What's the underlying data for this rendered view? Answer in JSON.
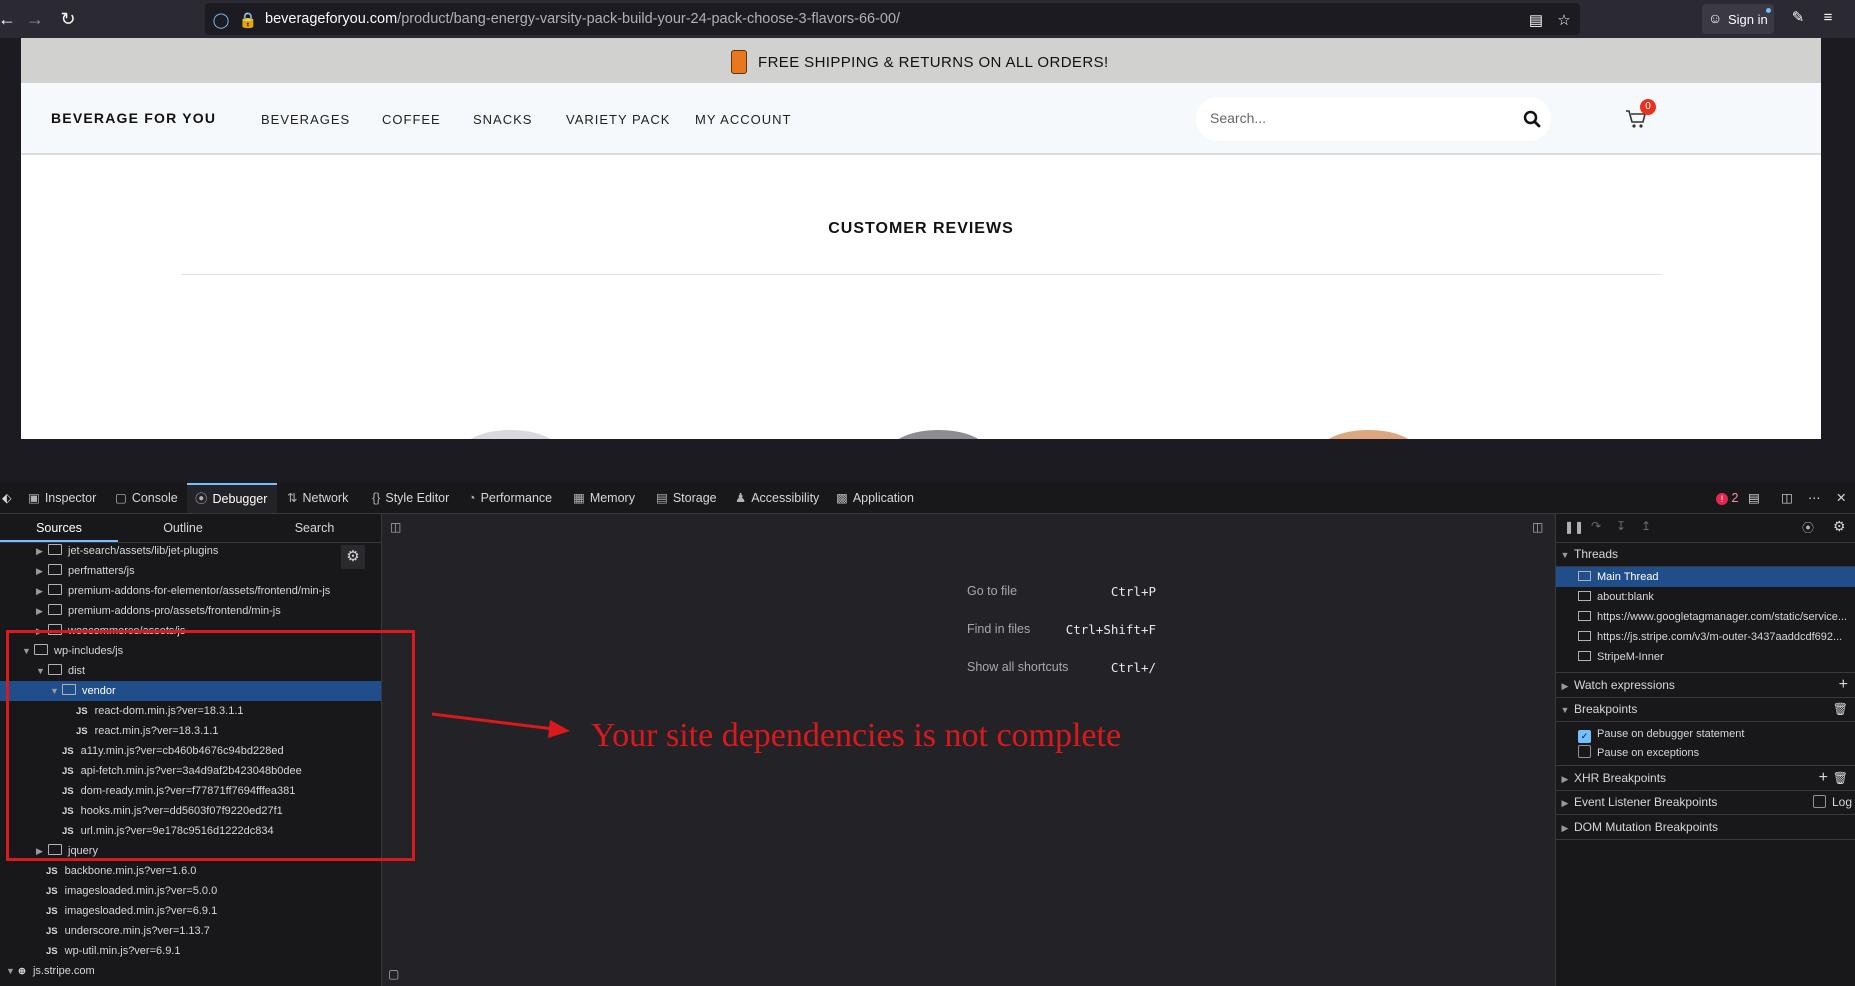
{
  "browser": {
    "url_domain": "beverageforyou.com",
    "url_path": "/product/bang-energy-varsity-pack-build-your-24-pack-choose-3-flavors-66-00/",
    "sign_in_label": "Sign in"
  },
  "site": {
    "promo": "FREE SHIPPING & RETURNS ON ALL ORDERS!",
    "logo": "BEVERAGE FOR YOU",
    "nav": [
      "BEVERAGES",
      "COFFEE",
      "SNACKS",
      "VARIETY PACK",
      "MY ACCOUNT"
    ],
    "search_placeholder": "Search...",
    "cart_count": "0",
    "reviews_title": "CUSTOMER REVIEWS"
  },
  "devtools": {
    "tabs": [
      "Inspector",
      "Console",
      "Debugger",
      "Network",
      "Style Editor",
      "Performance",
      "Memory",
      "Storage",
      "Accessibility",
      "Application"
    ],
    "active_tab": "Debugger",
    "error_count": "2",
    "source_tabs": [
      "Sources",
      "Outline",
      "Search"
    ],
    "tree": [
      {
        "label": "jet-search/assets/lib/jet-plugins",
        "kind": "folder"
      },
      {
        "label": "perfmatters/js",
        "kind": "folder"
      },
      {
        "label": "premium-addons-for-elementor/assets/frontend/min-js",
        "kind": "folder"
      },
      {
        "label": "premium-addons-pro/assets/frontend/min-js",
        "kind": "folder"
      },
      {
        "label": "woocommerce/assets/js",
        "kind": "folder"
      },
      {
        "label": "wp-includes/js",
        "kind": "folder"
      },
      {
        "label": "dist",
        "kind": "folder"
      },
      {
        "label": "vendor",
        "kind": "folder"
      },
      {
        "label": "react-dom.min.js?ver=18.3.1.1",
        "kind": "js"
      },
      {
        "label": "react.min.js?ver=18.3.1.1",
        "kind": "js"
      },
      {
        "label": "a11y.min.js?ver=cb460b4676c94bd228ed",
        "kind": "js"
      },
      {
        "label": "api-fetch.min.js?ver=3a4d9af2b423048b0dee",
        "kind": "js"
      },
      {
        "label": "dom-ready.min.js?ver=f77871ff7694fffea381",
        "kind": "js"
      },
      {
        "label": "hooks.min.js?ver=dd5603f07f9220ed27f1",
        "kind": "js"
      },
      {
        "label": "url.min.js?ver=9e178c9516d1222dc834",
        "kind": "js"
      },
      {
        "label": "jquery",
        "kind": "folder"
      },
      {
        "label": "backbone.min.js?ver=1.6.0",
        "kind": "js"
      },
      {
        "label": "imagesloaded.min.js?ver=5.0.0",
        "kind": "js"
      },
      {
        "label": "imagesloaded.min.js?ver=6.9.1",
        "kind": "js"
      },
      {
        "label": "underscore.min.js?ver=1.13.7",
        "kind": "js"
      },
      {
        "label": "wp-util.min.js?ver=6.9.1",
        "kind": "js"
      },
      {
        "label": "js.stripe.com",
        "kind": "domain"
      }
    ],
    "shortcuts": [
      {
        "key": "Ctrl+P",
        "desc": "Go to file"
      },
      {
        "key": "Ctrl+Shift+F",
        "desc": "Find in files"
      },
      {
        "key": "Ctrl+/",
        "desc": "Show all shortcuts"
      }
    ],
    "threads_header": "Threads",
    "threads": [
      "Main Thread",
      "about:blank",
      "https://www.googletagmanager.com/static/service...",
      "https://js.stripe.com/v3/m-outer-3437aaddcdf692...",
      "StripeM-Inner"
    ],
    "watch_header": "Watch expressions",
    "breakpoints_header": "Breakpoints",
    "pause_debugger": "Pause on debugger statement",
    "pause_exceptions": "Pause on exceptions",
    "xhr_header": "XHR Breakpoints",
    "event_header": "Event Listener Breakpoints",
    "log_label": "Log",
    "dom_header": "DOM Mutation Breakpoints"
  },
  "annotation": {
    "text": "Your site dependencies is not complete",
    "color": "#d9191c"
  }
}
